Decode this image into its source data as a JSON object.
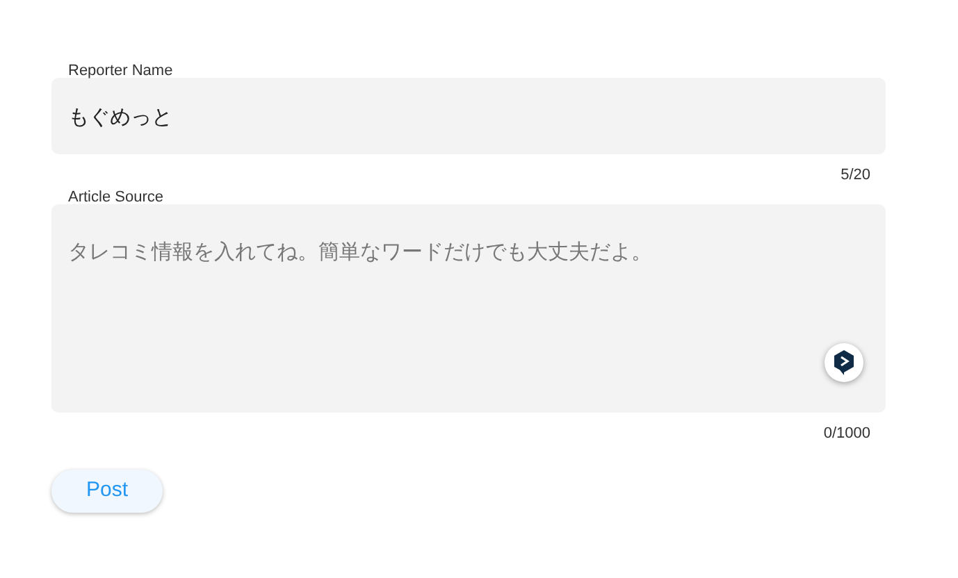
{
  "fields": [
    {
      "kind": "input",
      "label": "Reporter Name",
      "value": "もぐめっと",
      "counter": "5/20"
    },
    {
      "kind": "textarea",
      "label": "Article Source",
      "placeholder": "タレコミ情報を入れてね。簡単なワードだけでも大丈夫だよ。",
      "counter": "0/1000"
    }
  ],
  "button": {
    "label": "Post"
  }
}
